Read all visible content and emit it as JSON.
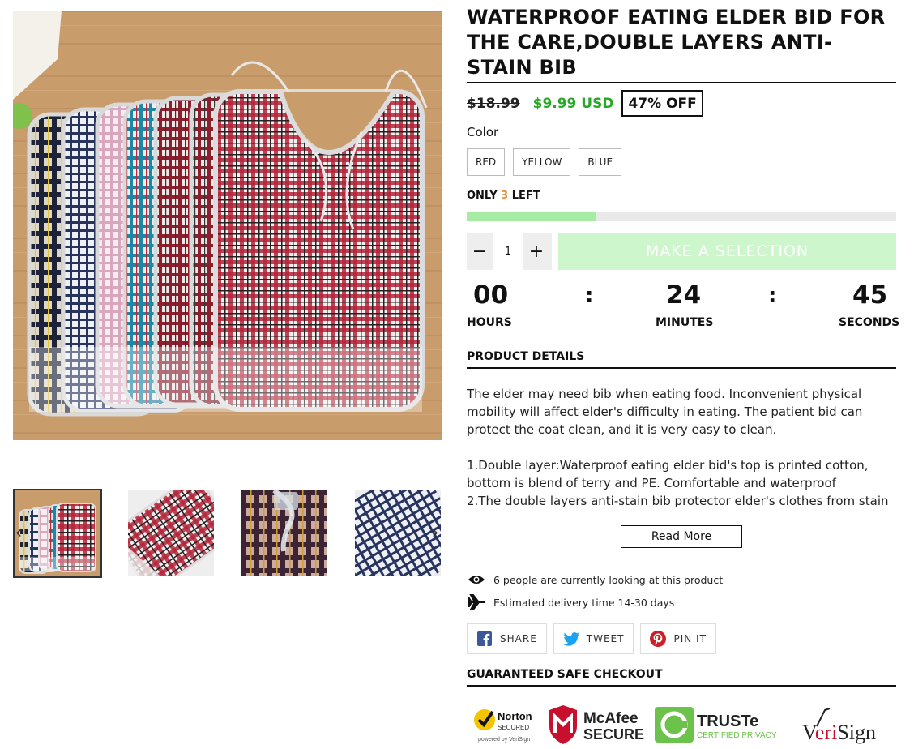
{
  "product": {
    "title": "WATERPROOF EATING ELDER BID FOR THE CARE,DOUBLE LAYERS ANTI-STAIN BIB",
    "old_price": "$18.99",
    "new_price": "$9.99 USD",
    "discount": "47% OFF"
  },
  "variants": {
    "label": "Color",
    "options": [
      "RED",
      "YELLOW",
      "BLUE"
    ]
  },
  "stock": {
    "prefix": "ONLY",
    "count": "3",
    "suffix": "LEFT",
    "level": 0.3
  },
  "cart": {
    "quantity": "1",
    "minus": "−",
    "plus": "+",
    "cta": "MAKE A SELECTION"
  },
  "timer": {
    "hours": "00",
    "minutes": "24",
    "seconds": "45",
    "sep": ":",
    "hours_label": "HOURS",
    "minutes_label": "MINUTES",
    "seconds_label": "SECONDS"
  },
  "details": {
    "heading": "PRODUCT DETAILS",
    "para1_lines": [
      "The elder may need bib when eating food. Inconvenient physical",
      "mobility will affect elder's difficulty in eating. The patient bid  can",
      "protect the coat clean, and it is very easy to clean."
    ],
    "para2_lines": [
      "1.Double layer:Waterproof eating elder bid's top is printed cotton,",
      "bottom is blend of terry and PE. Comfortable and waterproof",
      "2.The double layers anti-stain bib protector elder's clothes from stain"
    ],
    "read_more": "Read More"
  },
  "meta": {
    "viewers": "6 people are currently looking at this product",
    "delivery": "Estimated delivery time 14-30 days"
  },
  "share": {
    "facebook": "SHARE",
    "twitter": "TWEET",
    "pinterest": "PIN IT"
  },
  "checkout": {
    "heading": "GUARANTEED SAFE CHECKOUT",
    "badges": [
      "Norton SECURED",
      "McAfee SECURE",
      "TRUSTe CERTIFIED PRIVACY",
      "VeriSign"
    ],
    "norton_sub": "powered by VeriSign"
  },
  "colors": {
    "price_green": "#28a828",
    "stock_orange": "#f08a2c",
    "stock_fill": "#a7eca5",
    "cta_bg": "#cdf6cc"
  },
  "icons": [
    "eye-icon",
    "plane-icon",
    "facebook-icon",
    "twitter-icon",
    "pinterest-icon",
    "chevron-left-icon",
    "chevron-right-icon"
  ]
}
